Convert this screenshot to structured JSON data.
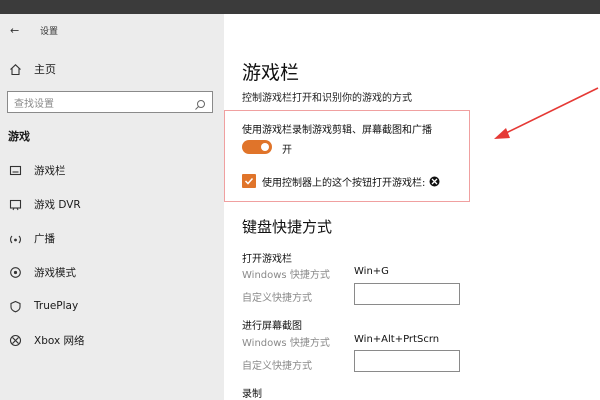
{
  "app": {
    "title": "设置"
  },
  "sidebar": {
    "home_label": "主页",
    "search_placeholder": "查找设置",
    "section_title": "游戏",
    "items": [
      {
        "label": "游戏栏",
        "icon": "game-bar-icon"
      },
      {
        "label": "游戏 DVR",
        "icon": "dvr-icon"
      },
      {
        "label": "广播",
        "icon": "broadcast-icon"
      },
      {
        "label": "游戏模式",
        "icon": "game-mode-icon"
      },
      {
        "label": "TruePlay",
        "icon": "trueplay-icon"
      },
      {
        "label": "Xbox 网络",
        "icon": "xbox-icon"
      }
    ]
  },
  "main": {
    "title": "游戏栏",
    "subtitle": "控制游戏栏打开和识别你的游戏的方式",
    "record_label": "使用游戏栏录制游戏剪辑、屏幕截图和广播",
    "toggle_state": "开",
    "toggle_on": true,
    "checkbox_label": "使用控制器上的这个按钮打开游戏栏:",
    "checkbox_checked": true,
    "keyboard_title": "键盘快捷方式",
    "shortcuts": [
      {
        "name": "打开游戏栏",
        "windows_label": "Windows 快捷方式",
        "windows_value": "Win+G",
        "custom_label": "自定义快捷方式",
        "custom_value": ""
      },
      {
        "name": "进行屏幕截图",
        "windows_label": "Windows 快捷方式",
        "windows_value": "Win+Alt+PrtScrn",
        "custom_label": "自定义快捷方式",
        "custom_value": ""
      }
    ],
    "next_section": "录制"
  },
  "colors": {
    "accent": "#e0742a",
    "annotation": "#e53935",
    "sidebar_bg": "#ececec"
  }
}
